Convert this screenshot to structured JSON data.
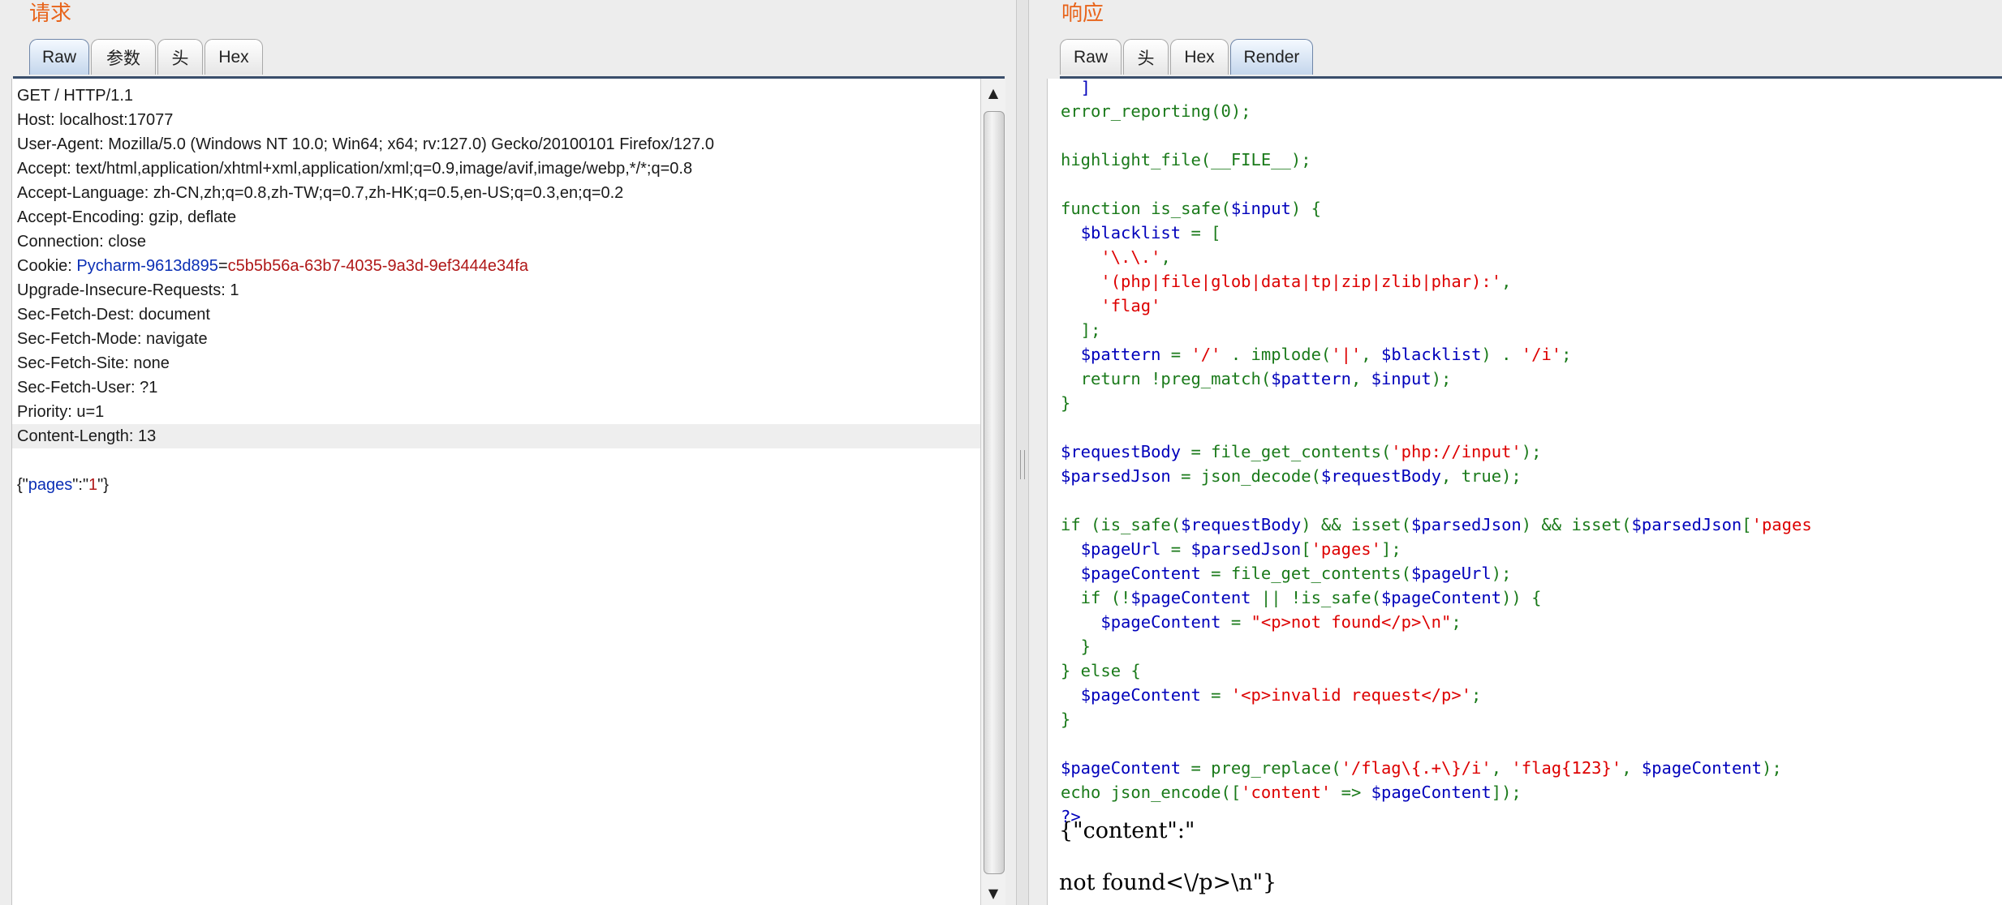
{
  "request_panel": {
    "title": "请求",
    "tabs": [
      "Raw",
      "参数",
      "头",
      "Hex"
    ],
    "lines": [
      "GET / HTTP/1.1",
      "Host: localhost:17077",
      "User-Agent: Mozilla/5.0 (Windows NT 10.0; Win64; x64; rv:127.0) Gecko/20100101 Firefox/127.0",
      "Accept: text/html,application/xhtml+xml,application/xml;q=0.9,image/avif,image/webp,*/*;q=0.8",
      "Accept-Language: zh-CN,zh;q=0.8,zh-TW;q=0.7,zh-HK;q=0.5,en-US;q=0.3,en;q=0.2",
      "Accept-Encoding: gzip, deflate",
      "Connection: close"
    ],
    "cookie_prefix": "Cookie: ",
    "cookie_name": "Pycharm-9613d895",
    "cookie_eq": "=",
    "cookie_value": "c5b5b56a-63b7-4035-9a3d-9ef3444e34fa",
    "lines_after_cookie": [
      "Upgrade-Insecure-Requests: 1",
      "Sec-Fetch-Dest: document",
      "Sec-Fetch-Mode: navigate",
      "Sec-Fetch-Site: none",
      "Sec-Fetch-User: ?1",
      "Priority: u=1"
    ],
    "highlighted_line": "Content-Length: 13",
    "body_open": "{\"",
    "body_key": "pages",
    "body_mid": "\":\"",
    "body_val": "1",
    "body_close": "\"}"
  },
  "response_panel": {
    "title": "响应",
    "tabs": [
      "Raw",
      "头",
      "Hex",
      "Render"
    ],
    "active_tab": "Render",
    "render_line1": "{\"content\":\"",
    "render_line2": "not found<\\/p>\\n\"}"
  },
  "colors": {
    "title": "#e8641b",
    "php_variable": "#0000bb",
    "php_string": "#dd0000",
    "php_keyword": "#1a7a1a",
    "cookie_name": "#0b2fb5",
    "cookie_value": "#b01818"
  },
  "icons": [
    "scroll-up-arrow-icon",
    "scroll-down-arrow-icon"
  ]
}
